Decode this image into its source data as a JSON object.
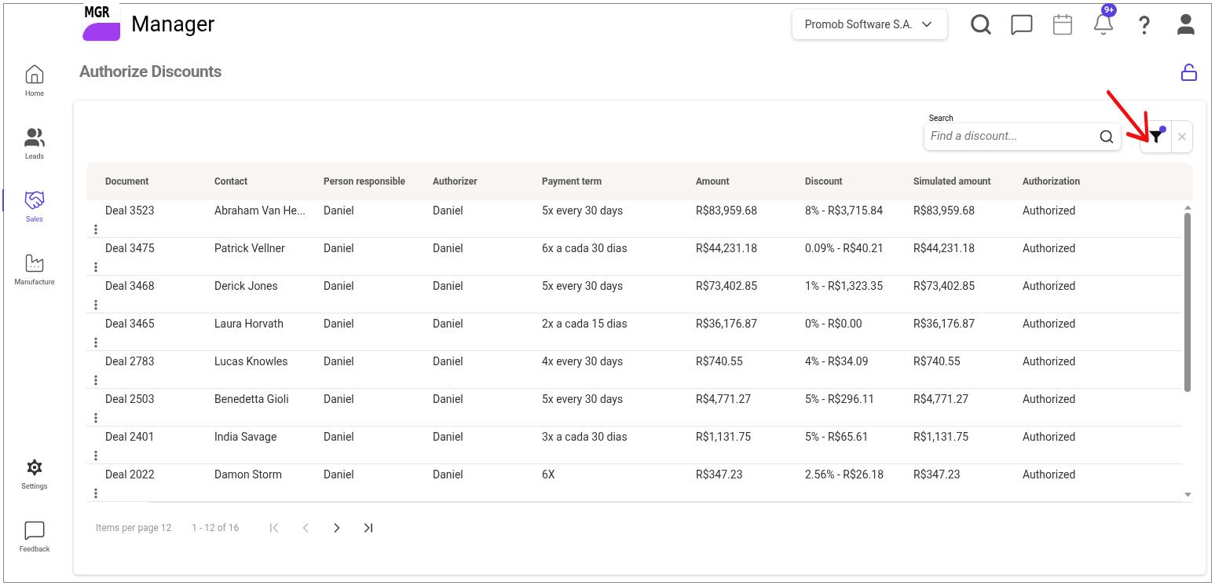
{
  "header": {
    "logo": "MGR",
    "app_name": "Manager",
    "company": "Promob Software S.A.",
    "notifications_badge": "9+"
  },
  "sidebar": {
    "items": [
      {
        "label": "Home",
        "kind": "home",
        "selected": false
      },
      {
        "label": "Leads",
        "kind": "leads",
        "selected": false
      },
      {
        "label": "Sales",
        "kind": "sales",
        "selected": true
      },
      {
        "label": "Manufacture",
        "kind": "manufacture",
        "selected": false
      }
    ],
    "bottom_items": [
      {
        "label": "Settings",
        "kind": "settings"
      },
      {
        "label": "Feedback",
        "kind": "feedback"
      }
    ]
  },
  "page_title": "Authorize Discounts",
  "search": {
    "label": "Search",
    "placeholder": "Find a discount..."
  },
  "filter": {
    "active": true
  },
  "table": {
    "columns": [
      "Document",
      "Contact",
      "Person responsible",
      "Authorizer",
      "Payment term",
      "Amount",
      "Discount",
      "Simulated amount",
      "Authorization"
    ],
    "rows": [
      [
        "Deal 3523",
        "Abraham Van He...",
        "Daniel",
        "Daniel",
        "5x every 30 days",
        "R$83,959.68",
        "8% - R$3,715.84",
        "R$83,959.68",
        "Authorized"
      ],
      [
        "Deal 3475",
        "Patrick Vellner",
        "Daniel",
        "Daniel",
        "6x a cada 30 dias",
        "R$44,231.18",
        "0.09% - R$40.21",
        "R$44,231.18",
        "Authorized"
      ],
      [
        "Deal 3468",
        "Derick Jones",
        "Daniel",
        "Daniel",
        "5x every 30 days",
        "R$73,402.85",
        "1% - R$1,323.35",
        "R$73,402.85",
        "Authorized"
      ],
      [
        "Deal 3465",
        "Laura Horvath",
        "Daniel",
        "Daniel",
        "2x a cada 15 dias",
        "R$36,176.87",
        "0% - R$0.00",
        "R$36,176.87",
        "Authorized"
      ],
      [
        "Deal 2783",
        "Lucas Knowles",
        "Daniel",
        "Daniel",
        "4x every 30 days",
        "R$740.55",
        "4% - R$34.09",
        "R$740.55",
        "Authorized"
      ],
      [
        "Deal 2503",
        "Benedetta Gioli",
        "Daniel",
        "Daniel",
        "5x every 30 days",
        "R$4,771.27",
        "5% - R$296.11",
        "R$4,771.27",
        "Authorized"
      ],
      [
        "Deal 2401",
        "India Savage",
        "Daniel",
        "Daniel",
        "3x a cada 30 dias",
        "R$1,131.75",
        "5% - R$65.61",
        "R$1,131.75",
        "Authorized"
      ],
      [
        "Deal 2022",
        "Damon Storm",
        "Daniel",
        "Daniel",
        "6X",
        "R$347.23",
        "2.56% - R$26.18",
        "R$347.23",
        "Authorized"
      ]
    ]
  },
  "pagination": {
    "items_per_page": "Items per page 12",
    "range": "1 - 12 of 16",
    "buttons": [
      {
        "kind": "first",
        "disabled": true
      },
      {
        "kind": "prev",
        "disabled": true
      },
      {
        "kind": "next",
        "disabled": false
      },
      {
        "kind": "last",
        "disabled": false
      }
    ]
  }
}
